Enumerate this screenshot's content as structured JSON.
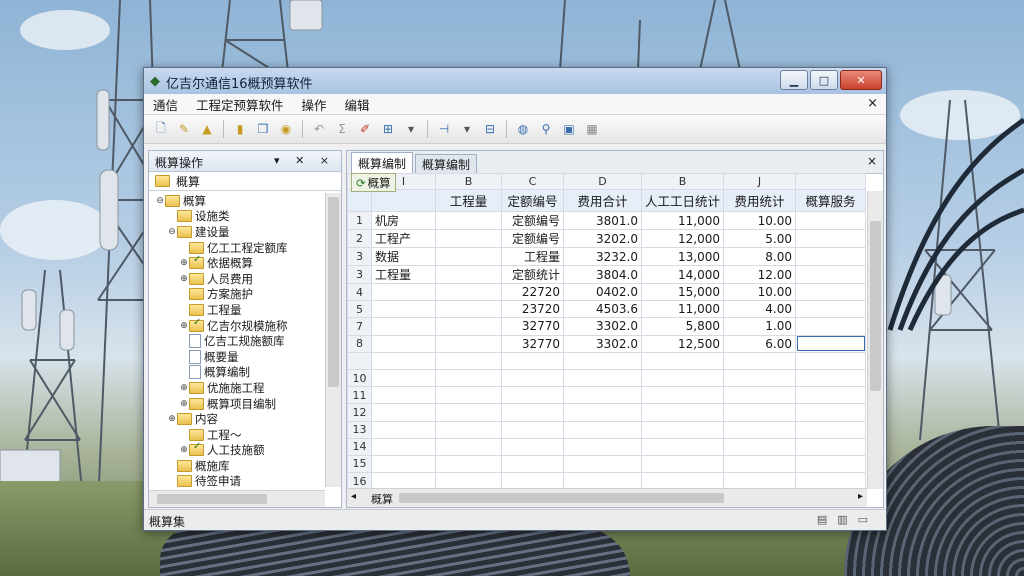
{
  "window": {
    "title": "亿吉尔通信16概预算软件"
  },
  "menubar": {
    "items": [
      "通信",
      "工程定预算软件",
      "操作",
      "编辑"
    ],
    "close": "×"
  },
  "toolbar": {
    "icons": [
      "new-icon",
      "open-icon",
      "save-icon",
      "cut-icon",
      "copy-icon",
      "paste-icon",
      "undo-icon",
      "sum-icon",
      "pencil-icon",
      "table-icon",
      "insert-row-icon",
      "dropdown-icon",
      "report-icon",
      "search-icon",
      "filter-icon",
      "calc-icon",
      "settings-icon"
    ]
  },
  "left_pane": {
    "title": "概算操作",
    "controls": "▾ ✕ ×",
    "tab": "概算",
    "tree": [
      {
        "toggle": "⊖",
        "icon": "folder",
        "label": "概算",
        "level": 0
      },
      {
        "toggle": "",
        "icon": "folder",
        "label": "设施类",
        "level": 1
      },
      {
        "toggle": "⊖",
        "icon": "folder",
        "label": "建设量",
        "level": 1
      },
      {
        "toggle": "",
        "icon": "folder",
        "label": "亿工工程定额库",
        "level": 2
      },
      {
        "toggle": "⊕",
        "icon": "folder-check",
        "label": "依据概算",
        "level": 2
      },
      {
        "toggle": "⊕",
        "icon": "folder",
        "label": "人员费用",
        "level": 2
      },
      {
        "toggle": "",
        "icon": "folder",
        "label": "方案施护",
        "level": 2
      },
      {
        "toggle": "",
        "icon": "folder",
        "label": "工程量",
        "level": 2
      },
      {
        "toggle": "⊕",
        "icon": "folder-check",
        "label": "亿吉尔规模施称",
        "level": 2
      },
      {
        "toggle": "",
        "icon": "doc",
        "label": "亿吉工规施额库",
        "level": 2
      },
      {
        "toggle": "",
        "icon": "doc",
        "label": "概要量",
        "level": 2
      },
      {
        "toggle": "",
        "icon": "doc",
        "label": "概算编制",
        "level": 2
      },
      {
        "toggle": "⊕",
        "icon": "folder",
        "label": "优施施工程",
        "level": 2
      },
      {
        "toggle": "⊕",
        "icon": "folder",
        "label": "概算项目编制",
        "level": 2
      },
      {
        "toggle": "⊕",
        "icon": "folder",
        "label": "内容",
        "level": 1
      },
      {
        "toggle": "",
        "icon": "folder",
        "label": "工程～",
        "level": 2
      },
      {
        "toggle": "⊕",
        "icon": "folder-check",
        "label": "人工技施额",
        "level": 2
      },
      {
        "toggle": "",
        "icon": "folder",
        "label": "概施库",
        "level": 1
      },
      {
        "toggle": "",
        "icon": "folder",
        "label": "待签申请",
        "level": 1
      }
    ]
  },
  "right_pane": {
    "tabs": [
      "概算编制",
      "概算编制"
    ],
    "tab_close": "×",
    "sheet_name": "概算",
    "column_letters": [
      "",
      "I",
      "B",
      "C",
      "D",
      "B",
      "J",
      ""
    ],
    "field_headers": [
      "",
      "",
      "工程量",
      "定额编号",
      "费用合计",
      "人工工日统计",
      "费用统计",
      "概算服务"
    ],
    "rows": [
      {
        "n": "1",
        "cells": [
          "机房",
          "",
          "定额编号",
          "3801.0",
          "11,000",
          "10.00",
          ""
        ]
      },
      {
        "n": "2",
        "cells": [
          "工程产",
          "",
          "定额编号",
          "3202.0",
          "12,000",
          "5.00",
          ""
        ]
      },
      {
        "n": "3",
        "cells": [
          "数据",
          "",
          "工程量",
          "3232.0",
          "13,000",
          "8.00",
          ""
        ]
      },
      {
        "n": "3",
        "cells": [
          "工程量",
          "",
          "定额统计",
          "3804.0",
          "14,000",
          "12.00",
          ""
        ]
      },
      {
        "n": "4",
        "cells": [
          "",
          "",
          "22720",
          "0402.0",
          "15,000",
          "10.00",
          ""
        ]
      },
      {
        "n": "5",
        "cells": [
          "",
          "",
          "23720",
          "4503.6",
          "11,000",
          "4.00",
          ""
        ]
      },
      {
        "n": "7",
        "cells": [
          "",
          "",
          "32770",
          "3302.0",
          "5,800",
          "1.00",
          ""
        ]
      },
      {
        "n": "8",
        "cells": [
          "",
          "",
          "32770",
          "3302.0",
          "12,500",
          "6.00",
          ""
        ]
      },
      {
        "n": "",
        "cells": [
          "",
          "",
          "",
          "",
          "",
          "",
          ""
        ]
      },
      {
        "n": "10",
        "cells": [
          "",
          "",
          "",
          "",
          "",
          "",
          ""
        ]
      },
      {
        "n": "11",
        "cells": [
          "",
          "",
          "",
          "",
          "",
          "",
          ""
        ]
      },
      {
        "n": "12",
        "cells": [
          "",
          "",
          "",
          "",
          "",
          "",
          ""
        ]
      },
      {
        "n": "13",
        "cells": [
          "",
          "",
          "",
          "",
          "",
          "",
          ""
        ]
      },
      {
        "n": "14",
        "cells": [
          "",
          "",
          "",
          "",
          "",
          "",
          ""
        ]
      },
      {
        "n": "15",
        "cells": [
          "",
          "",
          "",
          "",
          "",
          "",
          ""
        ]
      },
      {
        "n": "16",
        "cells": [
          "",
          "",
          "",
          "",
          "",
          "",
          ""
        ]
      }
    ],
    "sheet_bar_label": "概算"
  },
  "statusbar": {
    "text": "概算集"
  }
}
